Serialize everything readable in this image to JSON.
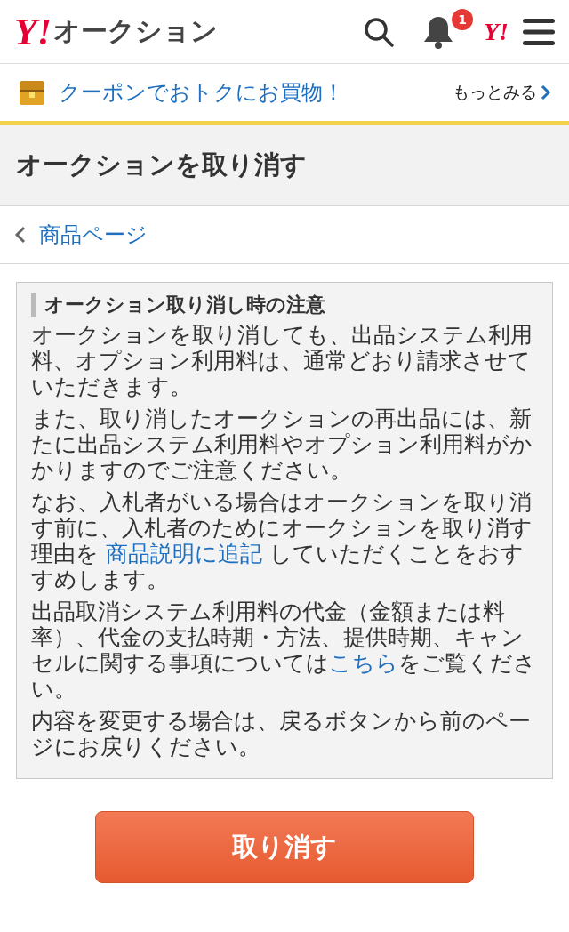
{
  "header": {
    "logo_mark": "Y!",
    "logo_text": "オークション",
    "notification_count": "1",
    "account_mark": "Y!"
  },
  "coupon_bar": {
    "text": "クーポンでおトクにお買物！",
    "more": "もっとみる"
  },
  "page_title": "オークションを取り消す",
  "back_link": "商品ページ",
  "notice": {
    "heading": "オークション取り消し時の注意",
    "paragraphs": [
      [
        {
          "text": "オークションを取り消しても、出品システム利用料、オプション利用料は、通常どおり請求させていただきます。",
          "kind": "text"
        }
      ],
      [
        {
          "text": "また、取り消したオークションの再出品には、新たに出品システム利用料やオプション利用料がかかりますのでご注意ください。",
          "kind": "text"
        }
      ],
      [
        {
          "text": "なお、入札者がいる場合はオークションを取り消す前に、入札者のためにオークションを取り消す理由を ",
          "kind": "text"
        },
        {
          "text": "商品説明に追記",
          "kind": "link"
        },
        {
          "text": " していただくことをおすすめします。",
          "kind": "text"
        }
      ],
      [
        {
          "text": "出品取消システム利用料の代金（金額または料率）、代金の支払時期・方法、提供時期、キャンセルに関する事項については",
          "kind": "text"
        },
        {
          "text": "こちら",
          "kind": "link"
        },
        {
          "text": "をご覧ください。",
          "kind": "text"
        }
      ],
      [
        {
          "text": "内容を変更する場合は、戻るボタンから前のページにお戻りください。",
          "kind": "text"
        }
      ]
    ]
  },
  "cancel_button": "取り消す"
}
